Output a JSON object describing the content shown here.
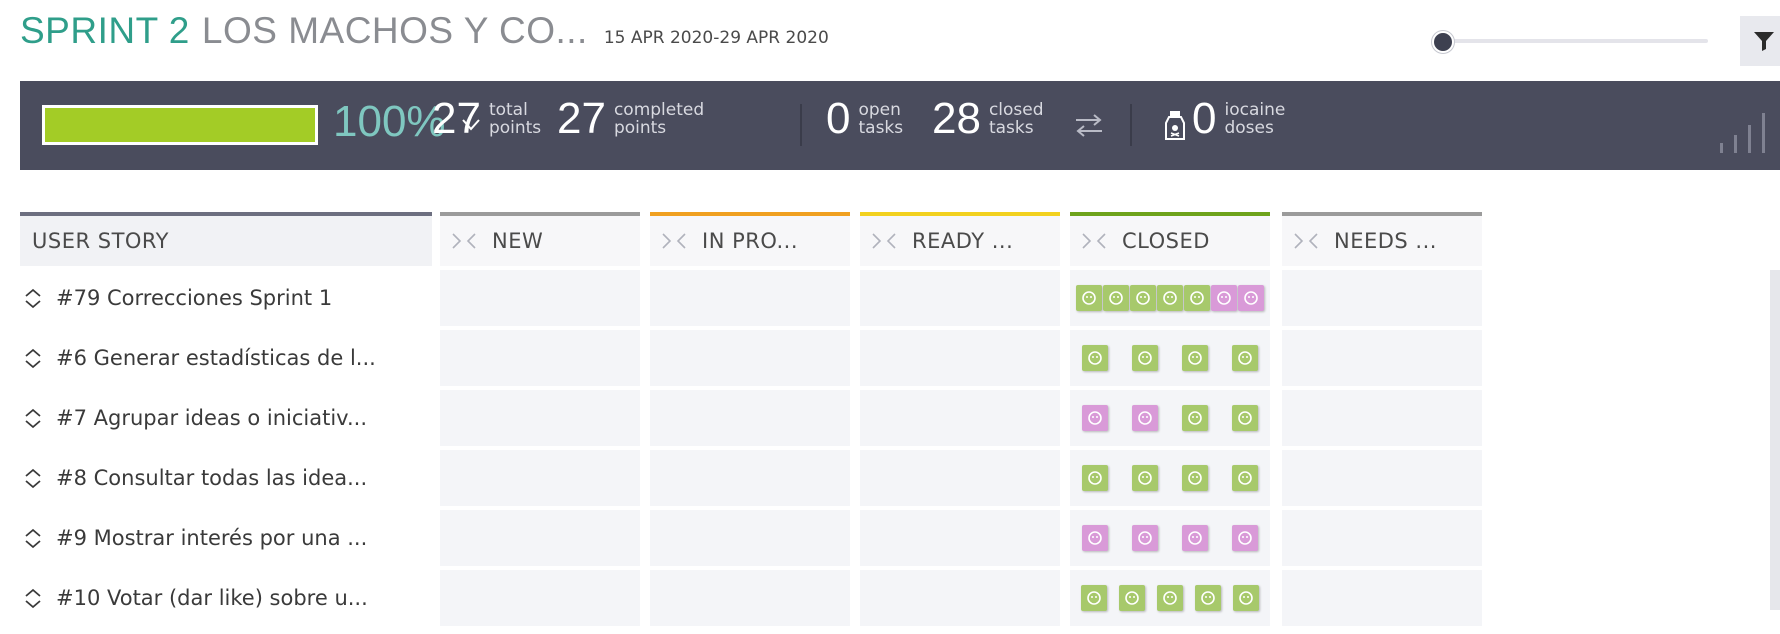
{
  "header": {
    "sprint": "SPRINT 2",
    "project": "LOS MACHOS Y CO...",
    "dates": "15 APR 2020-29 APR 2020",
    "zoom_level": 0
  },
  "summary": {
    "progress_percent": 100,
    "progress_label": "100%",
    "total_points": "27",
    "total_points_label_1": "total",
    "total_points_label_2": "points",
    "completed_points": "27",
    "completed_label_1": "completed",
    "completed_label_2": "points",
    "open_tasks": "0",
    "open_label_1": "open",
    "open_label_2": "tasks",
    "closed_tasks": "28",
    "closed_label_1": "closed",
    "closed_label_2": "tasks",
    "iocaine": "0",
    "iocaine_label_1": "iocaine",
    "iocaine_label_2": "doses",
    "progress_color": "#a3cc26"
  },
  "columns": [
    {
      "label": "USER STORY",
      "color": "#6d6f80"
    },
    {
      "label": "NEW",
      "color": "#9b9b9b"
    },
    {
      "label": "IN PRO...",
      "color": "#f0a020"
    },
    {
      "label": "READY ...",
      "color": "#f2d11f"
    },
    {
      "label": "CLOSED",
      "color": "#6ea31b"
    },
    {
      "label": "NEEDS ...",
      "color": "#9b9b9b"
    }
  ],
  "stories": [
    {
      "text": "#79 Correcciones Sprint 1",
      "avatars": [
        "green",
        "green",
        "green",
        "green",
        "green",
        "pink",
        "pink"
      ]
    },
    {
      "text": "#6 Generar estadísticas de l...",
      "avatars": [
        "green",
        "green",
        "green",
        "green"
      ]
    },
    {
      "text": "#7 Agrupar ideas o iniciativ...",
      "avatars": [
        "pink",
        "pink",
        "green",
        "green"
      ]
    },
    {
      "text": "#8 Consultar todas las idea...",
      "avatars": [
        "green",
        "green",
        "green",
        "green"
      ]
    },
    {
      "text": "#9 Mostrar interés por una ...",
      "avatars": [
        "pink",
        "pink",
        "pink",
        "pink"
      ]
    },
    {
      "text": "#10 Votar (dar like) sobre u...",
      "avatars": [
        "green",
        "green",
        "green",
        "green",
        "green"
      ]
    }
  ]
}
